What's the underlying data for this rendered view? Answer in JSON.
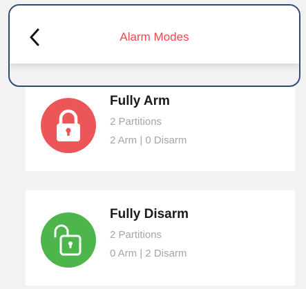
{
  "header": {
    "title": "Alarm Modes",
    "back_icon": "chevron-left-icon",
    "title_color": "#e8484c"
  },
  "modes": [
    {
      "title": "Fully Arm",
      "partitions": "2 Partitions",
      "status": "2 Arm | 0 Disarm",
      "icon": "lock-closed-icon",
      "icon_color": "#ed5659"
    },
    {
      "title": "Fully Disarm",
      "partitions": "2 Partitions",
      "status": "0 Arm | 2 Disarm",
      "icon": "lock-open-icon",
      "icon_color": "#4db54b"
    }
  ]
}
